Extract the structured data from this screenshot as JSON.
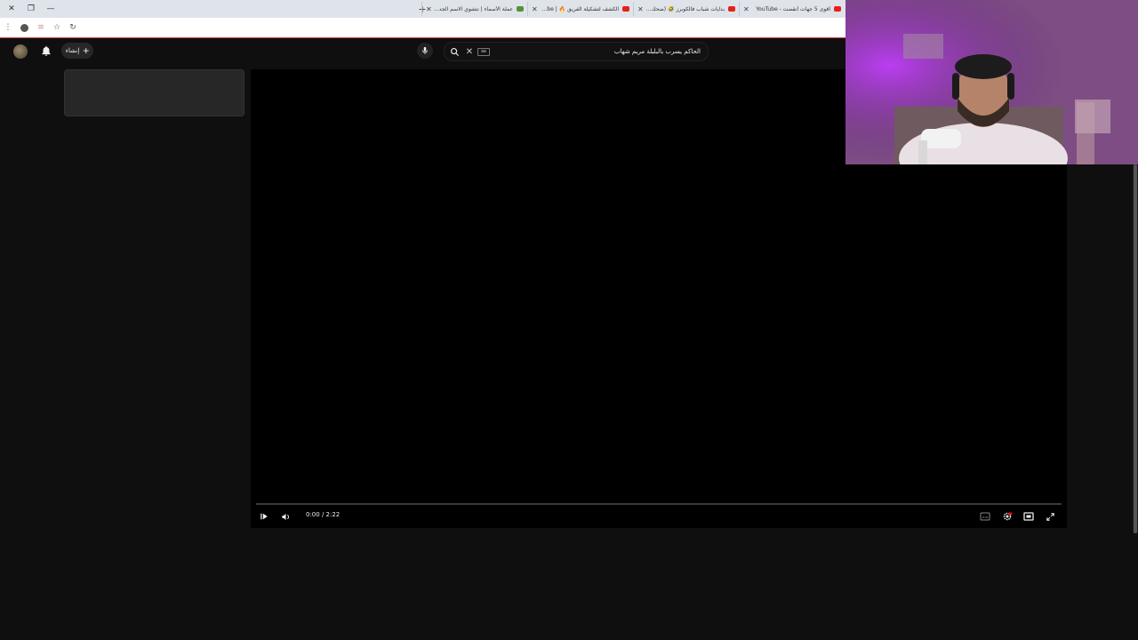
{
  "browser": {
    "window_controls": [
      "close",
      "restore",
      "minimize"
    ],
    "new_tab": "+",
    "tabs": [
      {
        "label": "أقوى 5 جهات أنقضت - YouTube",
        "active": false
      },
      {
        "label": "بدايات شباب فالكوبرز 🤣 (ضحك) ♦",
        "active": false
      },
      {
        "label": "الكشف لتشكيلة الفريق 🔥 | YouTube",
        "active": false
      },
      {
        "label": "عملة الأسماء | نتشوي الاسم الجد...",
        "active": false
      }
    ]
  },
  "header": {
    "create_label": "إنشاء",
    "search": {
      "value": "الحاكم يسرب بالبلبلة مريم شهاب",
      "keyboard_icon": "⌨"
    }
  },
  "player": {
    "time": "0:00 / 2:22",
    "progress": 0
  },
  "colors": {
    "background": "#0f0f0f",
    "player": "#000000",
    "accent": "#ff0000"
  },
  "icons": {
    "notifications": "bell-icon",
    "search": "search-icon",
    "mic": "mic-icon",
    "clear": "close-icon",
    "play": "play-icon",
    "volume": "volume-icon",
    "subtitles": "subtitles-icon",
    "settings": "gear-icon",
    "theater": "theater-icon",
    "fullscreen": "fullscreen-icon"
  }
}
